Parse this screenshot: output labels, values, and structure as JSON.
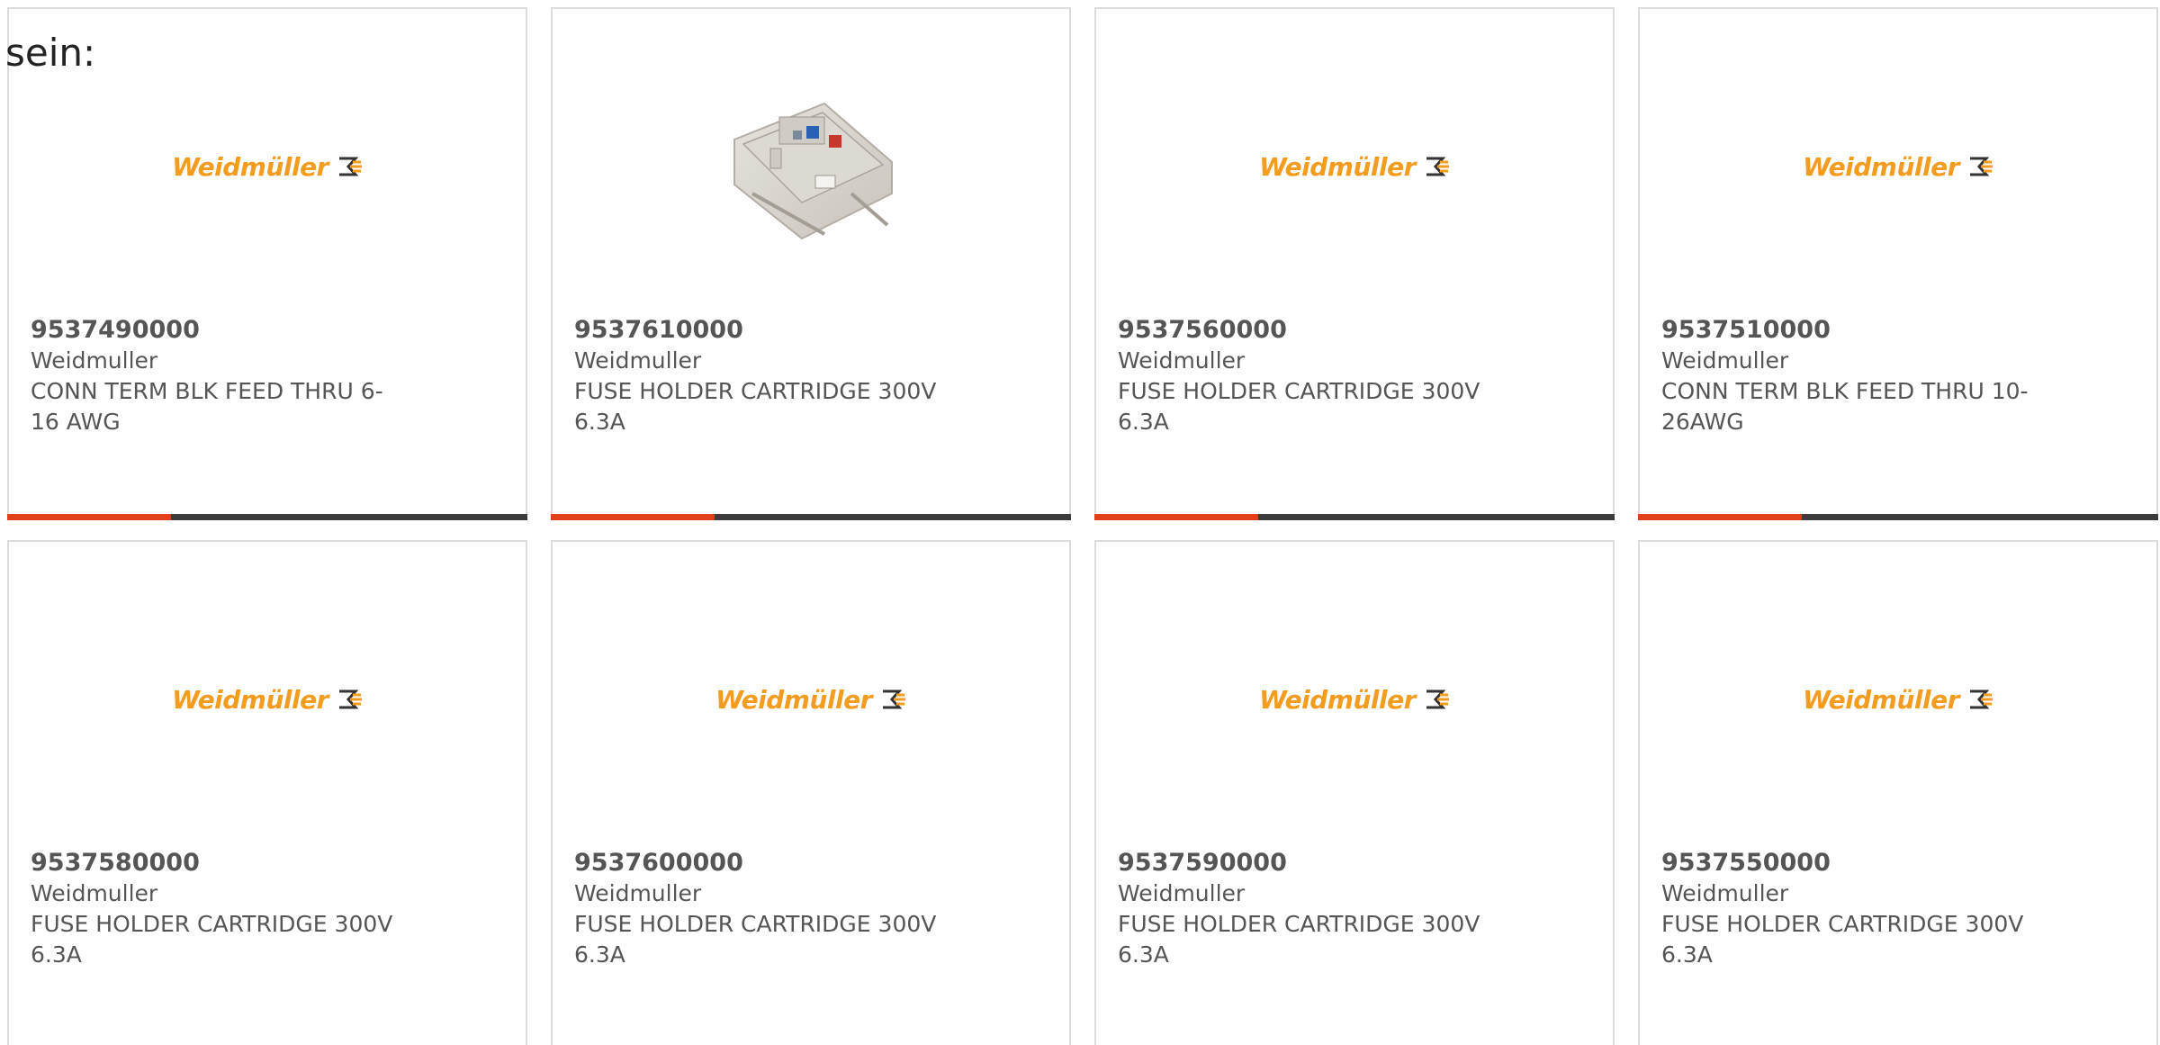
{
  "intro_text": "sein:",
  "brand_logo_text": "Weidmüller",
  "colors": {
    "logo": "#f39c1f",
    "bar_accent": "#e2401b",
    "bar_base": "#3c3c3c",
    "card_border": "#dddddd",
    "text": "#555555"
  },
  "products": [
    {
      "part_number": "9537490000",
      "manufacturer": "Weidmuller",
      "description": "CONN TERM BLK FEED THRU 6-16 AWG",
      "image": "weidmuller-logo"
    },
    {
      "part_number": "9537610000",
      "manufacturer": "Weidmuller",
      "description": "FUSE HOLDER CARTRIDGE 300V 6.3A",
      "image": "product-photo"
    },
    {
      "part_number": "9537560000",
      "manufacturer": "Weidmuller",
      "description": "FUSE HOLDER CARTRIDGE 300V 6.3A",
      "image": "weidmuller-logo"
    },
    {
      "part_number": "9537510000",
      "manufacturer": "Weidmuller",
      "description": "CONN TERM BLK FEED THRU 10-26AWG",
      "image": "weidmuller-logo"
    },
    {
      "part_number": "9537580000",
      "manufacturer": "Weidmuller",
      "description": "FUSE HOLDER CARTRIDGE 300V 6.3A",
      "image": "weidmuller-logo"
    },
    {
      "part_number": "9537600000",
      "manufacturer": "Weidmuller",
      "description": "FUSE HOLDER CARTRIDGE 300V 6.3A",
      "image": "weidmuller-logo"
    },
    {
      "part_number": "9537590000",
      "manufacturer": "Weidmuller",
      "description": "FUSE HOLDER CARTRIDGE 300V 6.3A",
      "image": "weidmuller-logo"
    },
    {
      "part_number": "9537550000",
      "manufacturer": "Weidmuller",
      "description": "FUSE HOLDER CARTRIDGE 300V 6.3A",
      "image": "weidmuller-logo"
    }
  ]
}
